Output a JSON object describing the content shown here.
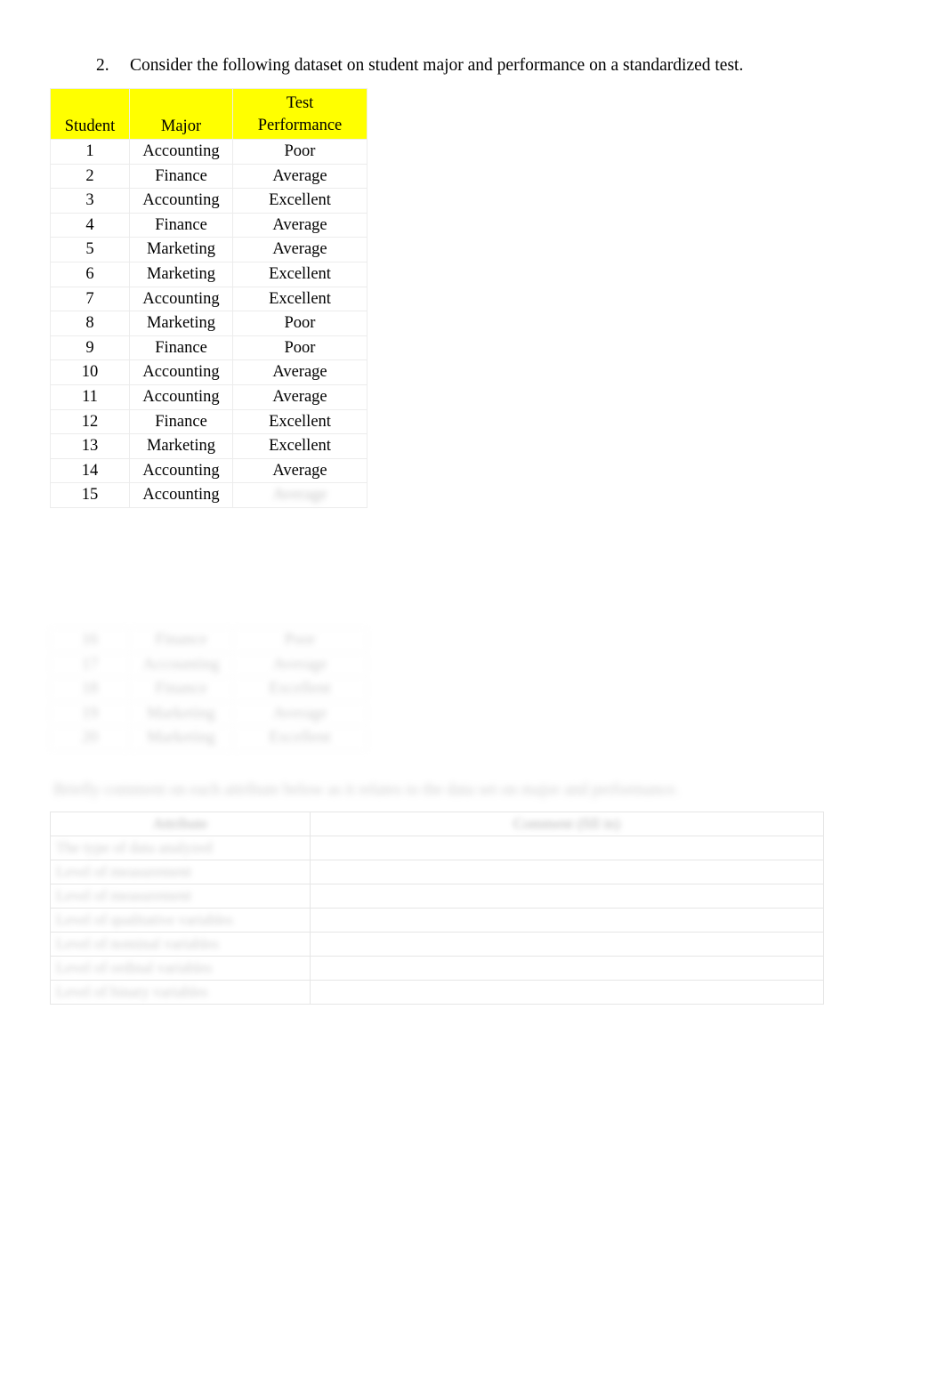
{
  "document": {
    "question": {
      "number": "2.",
      "text": "Consider the following dataset on student major and performance on a standardized test."
    },
    "dataset_table": {
      "headers": {
        "student": "Student",
        "major": "Major",
        "performance_line1": "Test",
        "performance_line2": "Performance"
      },
      "header_highlight_color": "#FFFF00",
      "rows": [
        {
          "student": "1",
          "major": "Accounting",
          "performance": "Poor"
        },
        {
          "student": "2",
          "major": "Finance",
          "performance": "Average"
        },
        {
          "student": "3",
          "major": "Accounting",
          "performance": "Excellent"
        },
        {
          "student": "4",
          "major": "Finance",
          "performance": "Average"
        },
        {
          "student": "5",
          "major": "Marketing",
          "performance": "Average"
        },
        {
          "student": "6",
          "major": "Marketing",
          "performance": "Excellent"
        },
        {
          "student": "7",
          "major": "Accounting",
          "performance": "Excellent"
        },
        {
          "student": "8",
          "major": "Marketing",
          "performance": "Poor"
        },
        {
          "student": "9",
          "major": "Finance",
          "performance": "Poor"
        },
        {
          "student": "10",
          "major": "Accounting",
          "performance": "Average"
        },
        {
          "student": "11",
          "major": "Accounting",
          "performance": "Average"
        },
        {
          "student": "12",
          "major": "Finance",
          "performance": "Excellent"
        },
        {
          "student": "13",
          "major": "Marketing",
          "performance": "Excellent"
        },
        {
          "student": "14",
          "major": "Accounting",
          "performance": "Average"
        },
        {
          "student": "15",
          "major": "Accounting",
          "performance": "Average"
        }
      ]
    },
    "secondary_table": {
      "rows": [
        {
          "student": "16",
          "major": "Finance",
          "performance": "Poor"
        },
        {
          "student": "17",
          "major": "Accounting",
          "performance": "Average"
        },
        {
          "student": "18",
          "major": "Finance",
          "performance": "Excellent"
        },
        {
          "student": "19",
          "major": "Marketing",
          "performance": "Average"
        },
        {
          "student": "20",
          "major": "Marketing",
          "performance": "Excellent"
        }
      ]
    },
    "prompt_line": "Briefly comment on each attribute below as it relates to the data set on major and performance.",
    "attributes_table": {
      "headers": {
        "attribute": "Attribute",
        "comment": "Comment (fill in)"
      },
      "rows": [
        {
          "attribute": "The type of data analyzed",
          "comment": ""
        },
        {
          "attribute": "Level of measurement",
          "comment": ""
        },
        {
          "attribute": "Level of measurement",
          "comment": ""
        },
        {
          "attribute": "Level of qualitative variables",
          "comment": ""
        },
        {
          "attribute": "Level of nominal variables",
          "comment": ""
        },
        {
          "attribute": "Level of ordinal variables",
          "comment": ""
        },
        {
          "attribute": "Level of binary variables",
          "comment": ""
        }
      ]
    }
  }
}
